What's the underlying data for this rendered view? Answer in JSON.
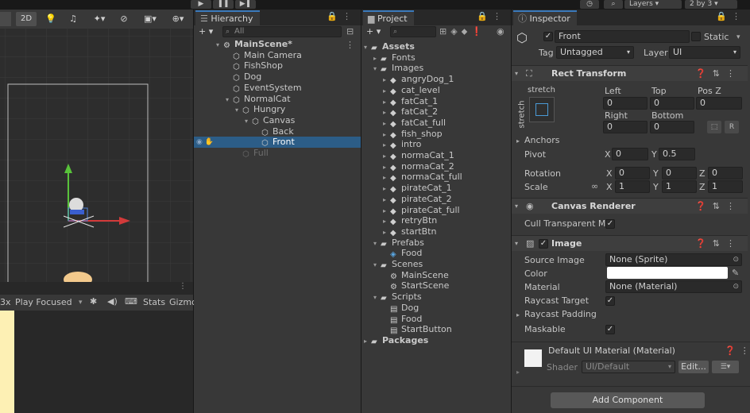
{
  "toolbar": {
    "layers_label": "Layers",
    "layout_label": "2 by 3"
  },
  "scene": {
    "btn_2d": "2D"
  },
  "game": {
    "play_focused": "Play Focused",
    "stats": "Stats",
    "gizmos": "Gizmo",
    "scale_label": "3x"
  },
  "hierarchy": {
    "tab": "Hierarchy",
    "search_placeholder": "All",
    "add": "+",
    "items": [
      {
        "label": "MainScene*",
        "depth": 0,
        "arrow": "▾",
        "icon": "unity-scene-icon",
        "bold": true
      },
      {
        "label": "Main Camera",
        "depth": 1,
        "arrow": "",
        "icon": "gameobject-icon"
      },
      {
        "label": "FishShop",
        "depth": 1,
        "arrow": "",
        "icon": "gameobject-icon"
      },
      {
        "label": "Dog",
        "depth": 1,
        "arrow": "",
        "icon": "gameobject-icon"
      },
      {
        "label": "EventSystem",
        "depth": 1,
        "arrow": "",
        "icon": "gameobject-icon"
      },
      {
        "label": "NormalCat",
        "depth": 1,
        "arrow": "▾",
        "icon": "gameobject-icon"
      },
      {
        "label": "Hungry",
        "depth": 2,
        "arrow": "▾",
        "icon": "gameobject-icon"
      },
      {
        "label": "Canvas",
        "depth": 3,
        "arrow": "▾",
        "icon": "gameobject-icon"
      },
      {
        "label": "Back",
        "depth": 4,
        "arrow": "",
        "icon": "gameobject-icon"
      },
      {
        "label": "Front",
        "depth": 4,
        "arrow": "",
        "icon": "gameobject-icon",
        "selected": true
      },
      {
        "label": "Full",
        "depth": 2,
        "arrow": "",
        "icon": "gameobject-icon",
        "disabled": true
      }
    ]
  },
  "project": {
    "tab": "Project",
    "add": "+",
    "items": [
      {
        "label": "Assets",
        "depth": 0,
        "arrow": "▾",
        "icon": "folder-icon",
        "bold": true
      },
      {
        "label": "Fonts",
        "depth": 1,
        "arrow": "▸",
        "icon": "folder-icon"
      },
      {
        "label": "Images",
        "depth": 1,
        "arrow": "▾",
        "icon": "folder-icon"
      },
      {
        "label": "angryDog_1",
        "depth": 2,
        "arrow": "▸",
        "icon": "sprite-icon"
      },
      {
        "label": "cat_level",
        "depth": 2,
        "arrow": "▸",
        "icon": "sprite-icon"
      },
      {
        "label": "fatCat_1",
        "depth": 2,
        "arrow": "▸",
        "icon": "sprite-icon"
      },
      {
        "label": "fatCat_2",
        "depth": 2,
        "arrow": "▸",
        "icon": "sprite-icon"
      },
      {
        "label": "fatCat_full",
        "depth": 2,
        "arrow": "▸",
        "icon": "sprite-icon"
      },
      {
        "label": "fish_shop",
        "depth": 2,
        "arrow": "▸",
        "icon": "sprite-icon"
      },
      {
        "label": "intro",
        "depth": 2,
        "arrow": "▸",
        "icon": "sprite-icon"
      },
      {
        "label": "normaCat_1",
        "depth": 2,
        "arrow": "▸",
        "icon": "sprite-icon"
      },
      {
        "label": "normaCat_2",
        "depth": 2,
        "arrow": "▸",
        "icon": "sprite-icon"
      },
      {
        "label": "normaCat_full",
        "depth": 2,
        "arrow": "▸",
        "icon": "sprite-icon"
      },
      {
        "label": "pirateCat_1",
        "depth": 2,
        "arrow": "▸",
        "icon": "sprite-icon"
      },
      {
        "label": "pirateCat_2",
        "depth": 2,
        "arrow": "▸",
        "icon": "sprite-icon"
      },
      {
        "label": "pirateCat_full",
        "depth": 2,
        "arrow": "▸",
        "icon": "sprite-icon"
      },
      {
        "label": "retryBtn",
        "depth": 2,
        "arrow": "▸",
        "icon": "sprite-icon"
      },
      {
        "label": "startBtn",
        "depth": 2,
        "arrow": "▸",
        "icon": "sprite-icon"
      },
      {
        "label": "Prefabs",
        "depth": 1,
        "arrow": "▾",
        "icon": "folder-icon"
      },
      {
        "label": "Food",
        "depth": 2,
        "arrow": "",
        "icon": "prefab-icon"
      },
      {
        "label": "Scenes",
        "depth": 1,
        "arrow": "▾",
        "icon": "folder-icon"
      },
      {
        "label": "MainScene",
        "depth": 2,
        "arrow": "",
        "icon": "unity-scene-icon"
      },
      {
        "label": "StartScene",
        "depth": 2,
        "arrow": "",
        "icon": "unity-scene-icon"
      },
      {
        "label": "Scripts",
        "depth": 1,
        "arrow": "▾",
        "icon": "folder-icon"
      },
      {
        "label": "Dog",
        "depth": 2,
        "arrow": "",
        "icon": "script-icon"
      },
      {
        "label": "Food",
        "depth": 2,
        "arrow": "",
        "icon": "script-icon"
      },
      {
        "label": "StartButton",
        "depth": 2,
        "arrow": "",
        "icon": "script-icon"
      },
      {
        "label": "Packages",
        "depth": 0,
        "arrow": "▸",
        "icon": "folder-icon",
        "bold": true
      }
    ]
  },
  "inspector": {
    "tab": "Inspector",
    "object_name": "Front",
    "static_label": "Static",
    "tag_label": "Tag",
    "tag_value": "Untagged",
    "layer_label": "Layer",
    "layer_value": "UI",
    "rect_transform": {
      "title": "Rect Transform",
      "preset": "stretch",
      "preset_side": "stretch",
      "left_label": "Left",
      "left": "0",
      "top_label": "Top",
      "top": "0",
      "posz_label": "Pos Z",
      "posz": "0",
      "right_label": "Right",
      "right": "0",
      "bottom_label": "Bottom",
      "bottom": "0",
      "anchors_label": "Anchors",
      "pivot_label": "Pivot",
      "pivot_x": "0",
      "pivot_y": "0.5",
      "rotation_label": "Rotation",
      "rot_x": "0",
      "rot_y": "0",
      "rot_z": "0",
      "scale_label": "Scale",
      "scale_x": "1",
      "scale_y": "1",
      "scale_z": "1",
      "x": "X",
      "y": "Y",
      "z": "Z"
    },
    "canvas_renderer": {
      "title": "Canvas Renderer",
      "cull_label": "Cull Transparent Me"
    },
    "image": {
      "title": "Image",
      "source_label": "Source Image",
      "source_value": "None (Sprite)",
      "color_label": "Color",
      "material_label": "Material",
      "material_value": "None (Material)",
      "raycast_target_label": "Raycast Target",
      "raycast_padding_label": "Raycast Padding",
      "maskable_label": "Maskable"
    },
    "material": {
      "title": "Default UI Material (Material)",
      "shader_label": "Shader",
      "shader_value": "UI/Default",
      "edit_label": "Edit..."
    },
    "add_component": "Add Component"
  }
}
